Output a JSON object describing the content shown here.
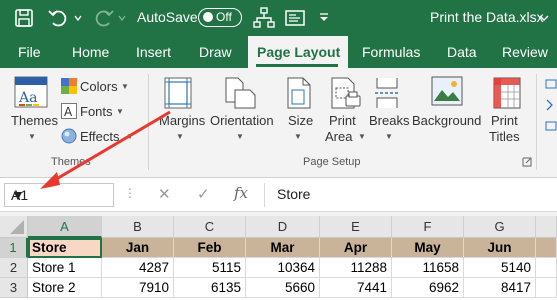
{
  "titlebar": {
    "autosave_label": "AutoSave",
    "autosave_state": "Off",
    "document_title": "Print the Data.xlsx"
  },
  "tabs": [
    {
      "label": "File"
    },
    {
      "label": "Home"
    },
    {
      "label": "Insert"
    },
    {
      "label": "Draw"
    },
    {
      "label": "Page Layout",
      "active": true
    },
    {
      "label": "Formulas"
    },
    {
      "label": "Data"
    },
    {
      "label": "Review"
    }
  ],
  "ribbon": {
    "themes_group": {
      "themes_label": "Themes",
      "colors_label": "Colors",
      "fonts_label": "Fonts",
      "effects_label": "Effects",
      "group_label": "Themes"
    },
    "page_setup_group": {
      "margins_label": "Margins",
      "orientation_label": "Orientation",
      "size_label": "Size",
      "print_area_line1": "Print",
      "print_area_line2": "Area",
      "breaks_label": "Breaks",
      "background_label": "Background",
      "print_titles_line1": "Print",
      "print_titles_line2": "Titles",
      "group_label": "Page Setup"
    }
  },
  "formula_bar": {
    "name_box": "A1",
    "cancel_symbol": "✕",
    "enter_symbol": "✓",
    "fx_symbol": "fx",
    "content": "Store"
  },
  "sheet": {
    "column_headers": [
      "A",
      "B",
      "C",
      "D",
      "E",
      "F",
      "G"
    ],
    "row_headers": [
      "1",
      "2",
      "3"
    ],
    "rows": [
      [
        "Store",
        "Jan",
        "Feb",
        "Mar",
        "Apr",
        "May",
        "Jun"
      ],
      [
        "Store 1",
        "4287",
        "5115",
        "10364",
        "11288",
        "11658",
        "5140"
      ],
      [
        "Store 2",
        "7910",
        "6135",
        "5660",
        "7441",
        "6962",
        "8417"
      ]
    ],
    "active_cell": "A1"
  },
  "colors": {
    "accent": "#217346",
    "header_fill": "#c9b49a",
    "store_header_fill": "#f8d8c4",
    "annotation_arrow": "#e8382f"
  }
}
